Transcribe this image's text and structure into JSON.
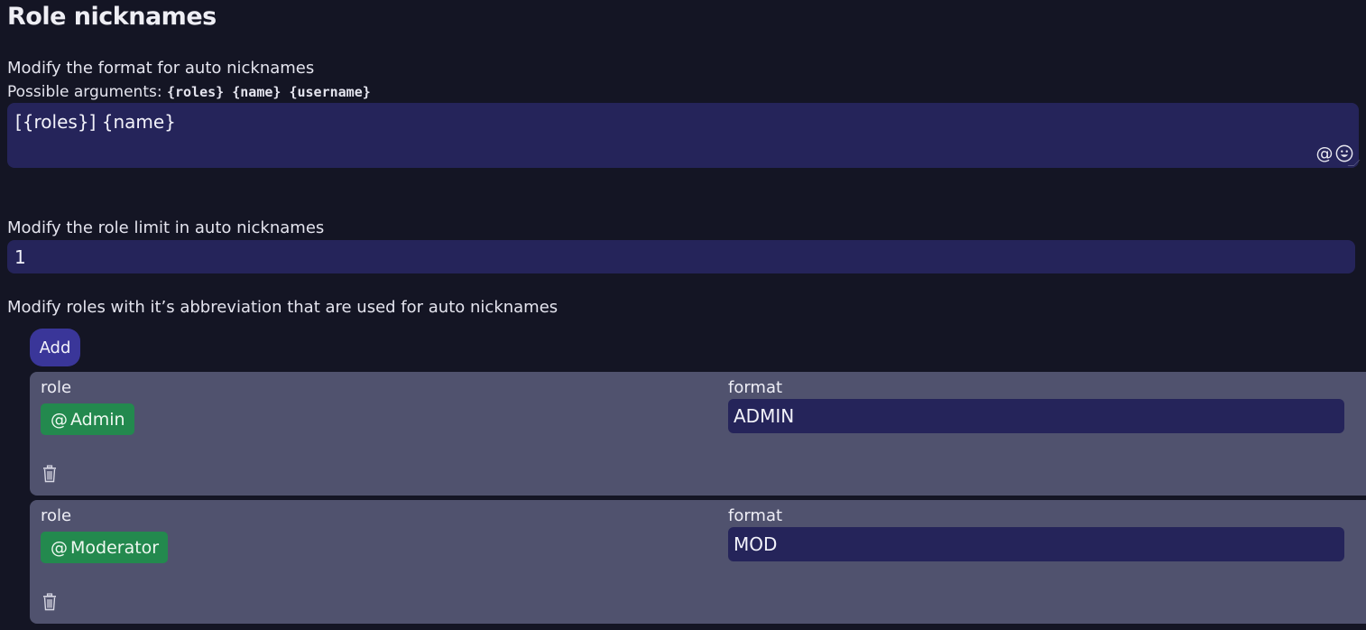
{
  "page": {
    "title": "Role nicknames"
  },
  "format_section": {
    "label": "Modify the format for auto nicknames",
    "args_prefix": "Possible arguments: ",
    "args": "{roles} {name} {username}",
    "value": "[{roles}] {name}",
    "mention_icon": "@",
    "emoji_icon": "smiley-icon"
  },
  "limit_section": {
    "label": "Modify the role limit in auto nicknames",
    "value": "1"
  },
  "roles_section": {
    "label": "Modify roles with it’s abbreviation that are used for auto nicknames",
    "add_label": "Add",
    "items": [
      {
        "role_label": "role",
        "role_name": "Admin",
        "format_label": "format",
        "format_value": "ADMIN"
      },
      {
        "role_label": "role",
        "role_name": "Moderator",
        "format_label": "format",
        "format_value": "MOD"
      }
    ]
  },
  "colors": {
    "background": "#141524",
    "input": "#25245a",
    "card": "#50526e",
    "role_badge": "#23894e",
    "add_button": "#3a3699"
  }
}
